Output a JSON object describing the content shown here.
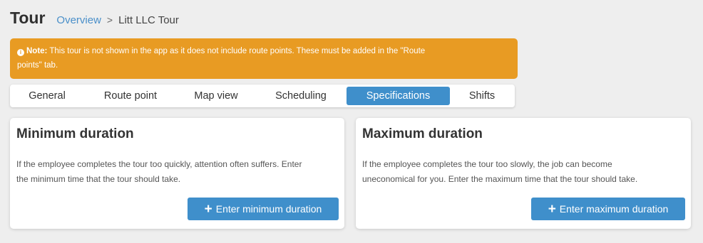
{
  "header": {
    "title": "Tour",
    "breadcrumb": {
      "link": "Overview",
      "separator": ">",
      "current": "Litt LLC Tour"
    }
  },
  "alert": {
    "icon": "info-icon",
    "label": "Note:",
    "text_line1": "This tour is not shown in the app as it does not include route points. These must be added in the \"Route",
    "text_line2": "points\" tab.",
    "color": "#e89b23"
  },
  "tabs": [
    {
      "label": "General",
      "active": false
    },
    {
      "label": "Route point",
      "active": false
    },
    {
      "label": "Map view",
      "active": false
    },
    {
      "label": "Scheduling",
      "active": false
    },
    {
      "label": "Specifications",
      "active": true
    },
    {
      "label": "Shifts",
      "active": false
    }
  ],
  "cards": {
    "minimum": {
      "title": "Minimum duration",
      "desc_line1": "If the employee completes the tour too quickly, attention often suffers. Enter",
      "desc_line2": "the minimum time that the tour should take.",
      "button_icon": "+",
      "button_label": "Enter minimum duration"
    },
    "maximum": {
      "title": "Maximum duration",
      "desc_line1": "If the employee completes the tour too slowly, the job can become",
      "desc_line2": "uneconomical for you. Enter the maximum time that the tour should take.",
      "button_icon": "+",
      "button_label": "Enter maximum duration"
    }
  },
  "colors": {
    "accent": "#3f8fcb",
    "warning": "#e89b23",
    "background": "#eeeeee"
  }
}
